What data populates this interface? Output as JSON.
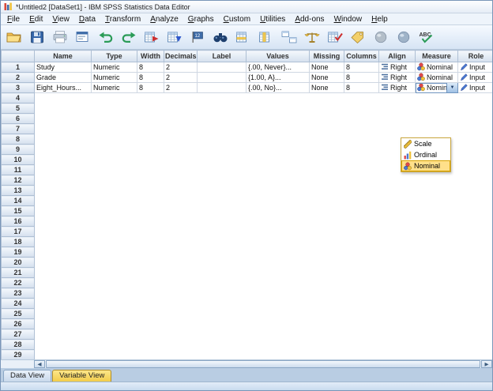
{
  "window": {
    "title": "*Untitled2 [DataSet1] - IBM SPSS Statistics Data Editor"
  },
  "menubar": {
    "items": [
      "File",
      "Edit",
      "View",
      "Data",
      "Transform",
      "Analyze",
      "Graphs",
      "Custom",
      "Utilities",
      "Add-ons",
      "Window",
      "Help"
    ]
  },
  "toolbar": {
    "icons": [
      "open-icon",
      "save-icon",
      "print-icon",
      "recall-dialogs-icon",
      "undo-icon",
      "redo-icon",
      "goto-case-icon",
      "goto-variable-icon",
      "variables-icon",
      "find-icon",
      "insert-cases-icon",
      "insert-variable-icon",
      "split-file-icon",
      "weight-cases-icon",
      "select-cases-icon",
      "value-labels-icon",
      "use-variable-sets-icon",
      "show-all-variables-icon",
      "spell-check-icon"
    ]
  },
  "grid": {
    "columns": [
      "",
      "Name",
      "Type",
      "Width",
      "Decimals",
      "Label",
      "Values",
      "Missing",
      "Columns",
      "Align",
      "Measure",
      "Role"
    ],
    "variables": [
      {
        "num": "1",
        "name": "Study",
        "type": "Numeric",
        "width": "8",
        "decimals": "2",
        "label": "",
        "values": "{.00, Never}...",
        "missing": "None",
        "columns": "8",
        "align": "Right",
        "measure": "Nominal",
        "role": "Input"
      },
      {
        "num": "2",
        "name": "Grade",
        "type": "Numeric",
        "width": "8",
        "decimals": "2",
        "label": "",
        "values": "{1.00, A}...",
        "missing": "None",
        "columns": "8",
        "align": "Right",
        "measure": "Nominal",
        "role": "Input"
      },
      {
        "num": "3",
        "name": "Eight_Hours...",
        "type": "Numeric",
        "width": "8",
        "decimals": "2",
        "label": "",
        "values": "{.00, No}...",
        "missing": "None",
        "columns": "8",
        "align": "Right",
        "measure": "Nominal",
        "role": "Input"
      }
    ],
    "empty_rows_from": 4,
    "empty_rows_to": 29
  },
  "measure_dropdown": {
    "anchor_row": "3",
    "options": [
      "Scale",
      "Ordinal",
      "Nominal"
    ],
    "selected": "Nominal"
  },
  "tabs": {
    "items": [
      "Data View",
      "Variable View"
    ],
    "active": "Variable View"
  },
  "colors": {
    "selection_yellow": "#ffe08a",
    "header_blue": "#d5e0ee",
    "active_tab_yellow": "#f2cc4b"
  }
}
